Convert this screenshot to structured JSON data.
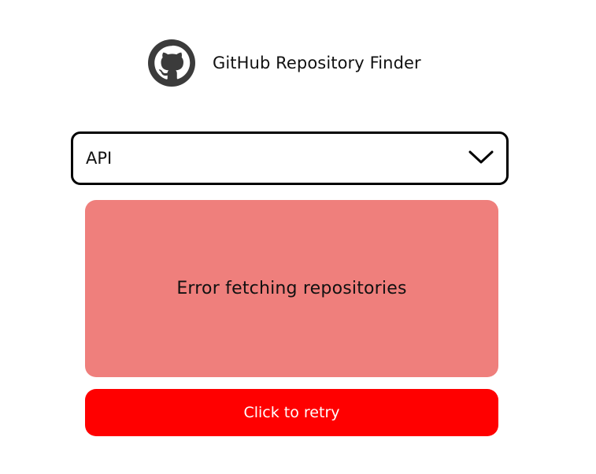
{
  "header": {
    "title": "GitHub Repository Finder",
    "logo_icon": "github-octocat-icon"
  },
  "language_select": {
    "selected_value": "API",
    "icon": "chevron-down-icon"
  },
  "error": {
    "message": "Error fetching repositories"
  },
  "retry": {
    "label": "Click to retry"
  },
  "colors": {
    "error_background": "#ef7f7c",
    "retry_background": "#ff0000",
    "logo_color": "#3b3b3b",
    "select_border": "#000000"
  }
}
